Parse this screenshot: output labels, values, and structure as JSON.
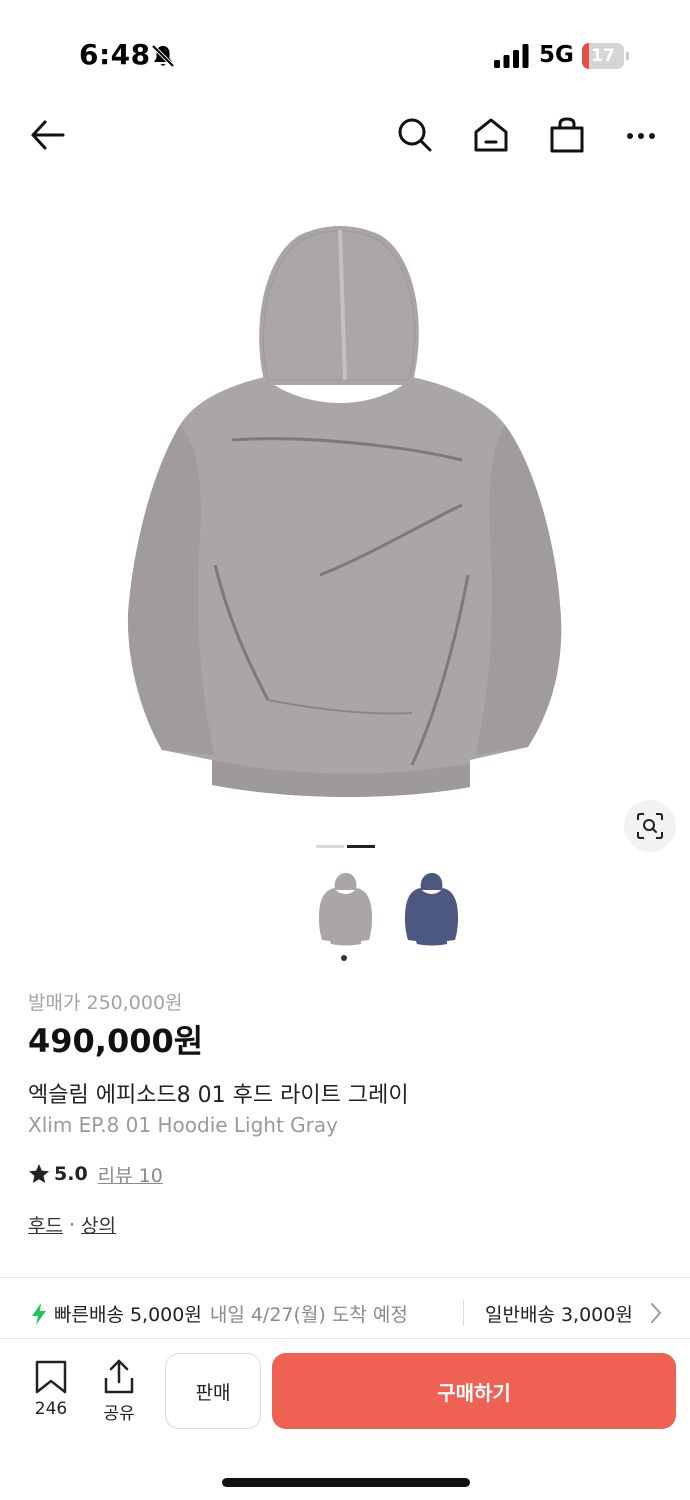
{
  "status_bar": {
    "time": "6:48",
    "network": "5G",
    "battery_level": "17",
    "battery_fraction": 0.17
  },
  "nav": {
    "icons": [
      "back-arrow-icon",
      "search-icon",
      "home-icon",
      "shopping-bag-icon",
      "more-icon"
    ]
  },
  "gallery": {
    "slide_count": 2,
    "active_slide": 2,
    "thumbnails": [
      {
        "name": "light-gray-hoodie",
        "color": "#a9a5a8"
      },
      {
        "name": "navy-hoodie",
        "color": "#4d5880"
      }
    ],
    "selected_thumbnail": 1
  },
  "product": {
    "release_price_label": "발매가 250,000원",
    "price": "490,000원",
    "name_ko": "엑슬림 에피소드8 01 후드 라이트 그레이",
    "name_en": "Xlim EP.8 01 Hoodie Light Gray",
    "rating": "5.0",
    "review_label": "리뷰 10",
    "categories": [
      "후드",
      "상의"
    ],
    "category_separator": "·",
    "body_color": "#a9a5a8"
  },
  "shipping": {
    "fast_title": "빠른배송 5,000원",
    "fast_note": "내일 4/27(월) 도착 예정",
    "normal": "일반배송 3,000원",
    "accent_color": "#22c55e"
  },
  "bottom_bar": {
    "save_count": "246",
    "share_label": "공유",
    "sell_label": "판매",
    "buy_label": "구매하기",
    "buy_color": "#ef6253"
  }
}
